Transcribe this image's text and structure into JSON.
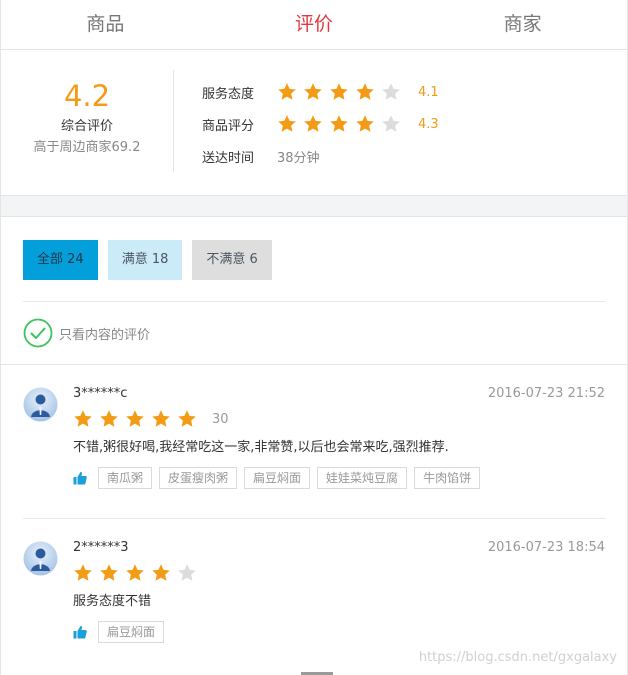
{
  "tabs": [
    {
      "label": "商品",
      "active": false
    },
    {
      "label": "评价",
      "active": true
    },
    {
      "label": "商家",
      "active": false
    }
  ],
  "overview": {
    "score": "4.2",
    "score_label": "综合评价",
    "compare_text": "高于周边商家69.2",
    "service": {
      "label": "服务态度",
      "stars": 4,
      "score": "4.1"
    },
    "food": {
      "label": "商品评分",
      "stars": 4,
      "score": "4.3"
    },
    "delivery": {
      "label": "送达时间",
      "value": "38分钟"
    }
  },
  "filters": {
    "all": "全部 24",
    "good": "满意 18",
    "bad": "不满意 6",
    "only_content": "只看内容的评价"
  },
  "reviews": [
    {
      "user": "3******c",
      "time": "2016-07-23 21:52",
      "stars": 5,
      "delivery": "30",
      "text": "不错,粥很好喝,我经常吃这一家,非常赞,以后也会常来吃,强烈推荐.",
      "tags": [
        "南瓜粥",
        "皮蛋瘦肉粥",
        "扁豆焖面",
        "娃娃菜炖豆腐",
        "牛肉馅饼"
      ]
    },
    {
      "user": "2******3",
      "time": "2016-07-23 18:54",
      "stars": 4,
      "delivery": "",
      "text": "服务态度不错",
      "tags": [
        "扁豆焖面"
      ]
    }
  ],
  "watermark": "https://blog.csdn.net/gxgalaxy",
  "colors": {
    "accent_red": "#e0383e",
    "star_orange": "#f49b16",
    "filter_blue": "#029fdb",
    "filter_light_blue": "#ccebf8",
    "check_green": "#3cc35e",
    "thumb_blue": "#1aa0db"
  },
  "icons": {
    "star": "star-icon",
    "check": "check-circle-icon",
    "thumb": "thumbs-up-icon",
    "avatar": "user-avatar-icon"
  }
}
